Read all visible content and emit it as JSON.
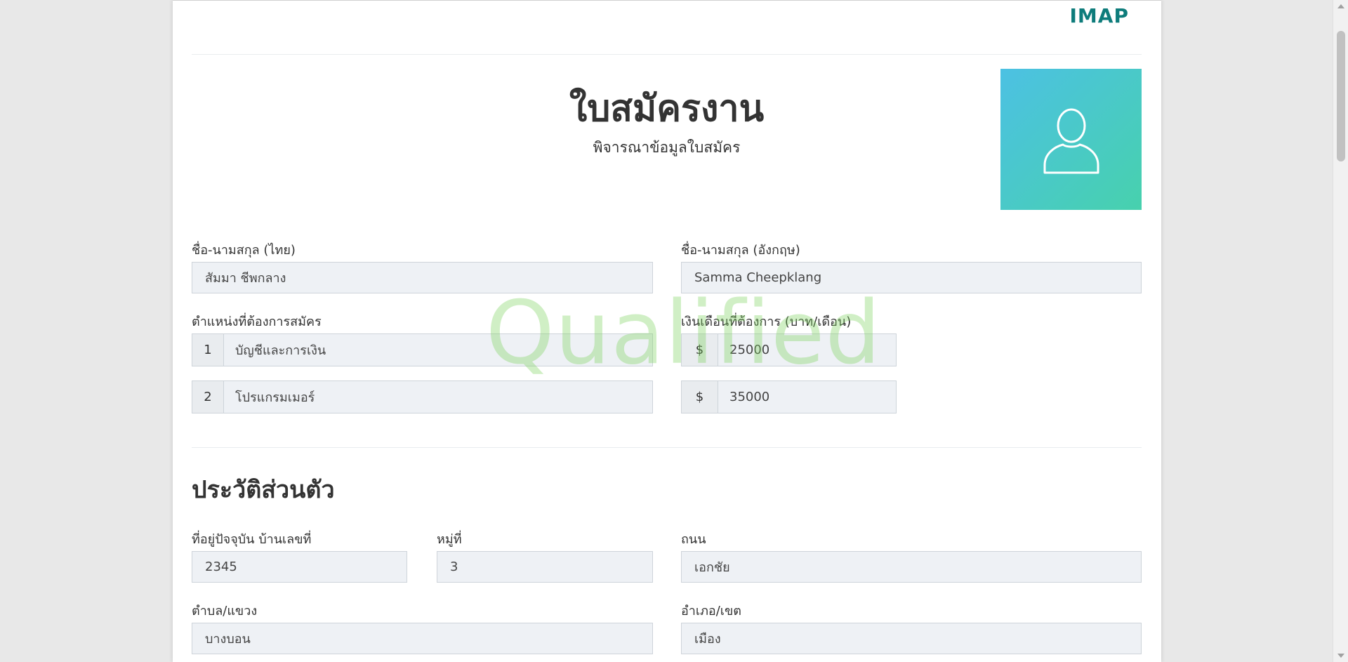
{
  "header": {
    "brand": "IMAP"
  },
  "form": {
    "title": "ใบสมัครงาน",
    "subtitle": "พิจารณาข้อมูลใบสมัคร",
    "photo_icon": "user-silhouette-icon",
    "watermark": "Qualified",
    "name_th": {
      "label": "ชื่อ-นามสกุล (ไทย)",
      "value": "สัมมา ชีพกลาง"
    },
    "name_en": {
      "label": "ชื่อ-นามสกุล (อังกฤษ)",
      "value": "Samma Cheepklang"
    },
    "positions": {
      "label": "ตำแหน่งที่ต้องการสมัคร",
      "items": [
        {
          "index": "1",
          "value": "บัญชีและการเงิน"
        },
        {
          "index": "2",
          "value": "โปรแกรมเมอร์"
        }
      ]
    },
    "salary": {
      "label": "เงินเดือนที่ต้องการ (บาท/เดือน)",
      "currency": "$",
      "items": [
        "25000",
        "35000"
      ]
    }
  },
  "personal": {
    "section_title": "ประวัติส่วนตัว",
    "house_no": {
      "label": "ที่อยู่ปัจจุบัน บ้านเลขที่",
      "value": "2345"
    },
    "moo": {
      "label": "หมู่ที่",
      "value": "3"
    },
    "road": {
      "label": "ถนน",
      "value": "เอกชัย"
    },
    "subdistrict": {
      "label": "ตำบล/แขวง",
      "value": "บางบอน"
    },
    "district": {
      "label": "อำเภอ/เขต",
      "value": "เมือง"
    }
  },
  "colors": {
    "brand": "#0e7c7b",
    "photo_gradient_start": "#4cc1e3",
    "photo_gradient_end": "#47d1ad",
    "watermark": "#78d25a",
    "field_bg": "#eef1f5"
  }
}
